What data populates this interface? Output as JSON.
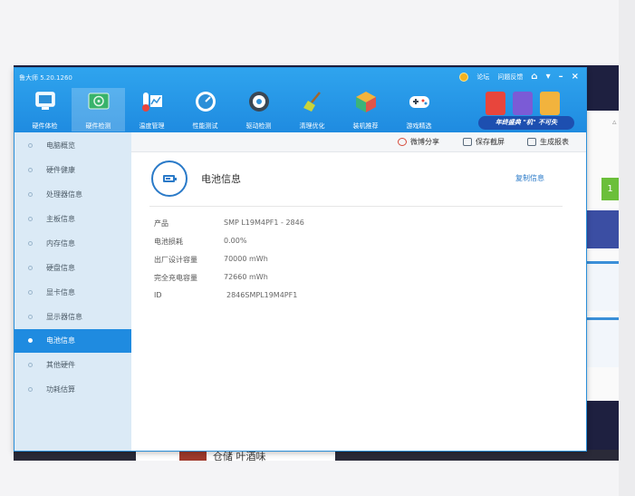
{
  "app": {
    "title": "鲁大师 5.20.1260",
    "title_links": [
      "论坛",
      "问题反馈"
    ],
    "controls": [
      "⌂",
      "▾",
      "–",
      "×"
    ]
  },
  "toolbar": [
    {
      "label": "硬件体检",
      "icon": "monitor-icon"
    },
    {
      "label": "硬件检测",
      "icon": "chip-icon",
      "active": true
    },
    {
      "label": "温度管理",
      "icon": "thermometer-icon"
    },
    {
      "label": "性能测试",
      "icon": "gauge-icon"
    },
    {
      "label": "驱动检测",
      "icon": "driver-gear-icon"
    },
    {
      "label": "清理优化",
      "icon": "broom-icon"
    },
    {
      "label": "装机推荐",
      "icon": "cube-icon"
    },
    {
      "label": "游戏精选",
      "icon": "gamepad-icon"
    }
  ],
  "promo": {
    "text": "年终盛典 \"机\" 不可失"
  },
  "sidebar": [
    {
      "label": "电脑概览"
    },
    {
      "label": "硬件健康"
    },
    {
      "label": "处理器信息"
    },
    {
      "label": "主板信息"
    },
    {
      "label": "内存信息"
    },
    {
      "label": "硬盘信息"
    },
    {
      "label": "显卡信息"
    },
    {
      "label": "显示器信息"
    },
    {
      "label": "电池信息",
      "active": true
    },
    {
      "label": "其他硬件"
    },
    {
      "label": "功耗估算"
    }
  ],
  "actions": {
    "share": "微博分享",
    "save": "保存截屏",
    "report": "生成报表"
  },
  "section": {
    "title": "电池信息",
    "copy": "复制信息"
  },
  "info": [
    {
      "key": "产品",
      "value": "SMP L19M4PF1 - 2846"
    },
    {
      "key": "电池损耗",
      "value": "0.00%"
    },
    {
      "key": "出厂设计容量",
      "value": "70000 mWh"
    },
    {
      "key": "完全充电容量",
      "value": "72660 mWh"
    },
    {
      "key": "ID",
      "value": "2846SMPL19M4PF1"
    }
  ],
  "background": {
    "badge": "1",
    "taskbar_text": "仓储  叶酒味"
  },
  "colors": {
    "accent": "#1f8be0",
    "sidebar_bg": "#dbeaf6",
    "link": "#2a7ac8"
  }
}
